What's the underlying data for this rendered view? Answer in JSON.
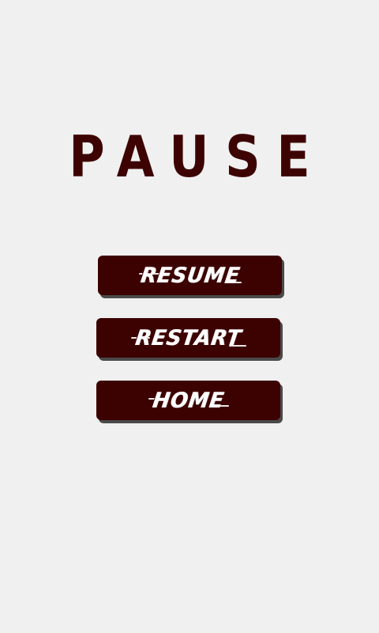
{
  "pause_menu": {
    "title": "PAUSE",
    "buttons": {
      "resume_label": "RESUME",
      "restart_label": "RESTART",
      "home_label": "HOME"
    }
  },
  "colors": {
    "background": "#f0f0f0",
    "title_text": "#3d0303",
    "button_fill": "#3c0101",
    "button_shadow": "#4a4a4a",
    "button_text": "#ffffff"
  }
}
